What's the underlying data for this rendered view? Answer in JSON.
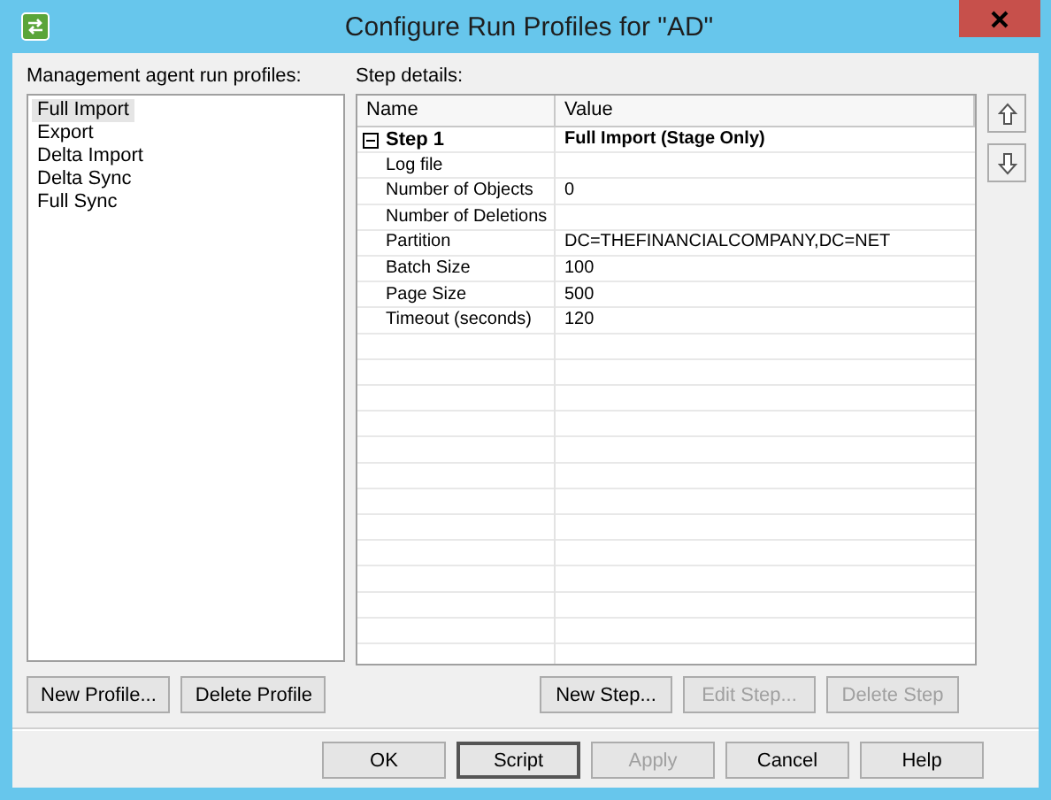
{
  "window": {
    "title": "Configure Run Profiles for \"AD\""
  },
  "profiles": {
    "label": "Management agent run profiles:",
    "items": [
      {
        "label": "Full Import",
        "selected": true
      },
      {
        "label": "Export",
        "selected": false
      },
      {
        "label": "Delta Import",
        "selected": false
      },
      {
        "label": "Delta Sync",
        "selected": false
      },
      {
        "label": "Full Sync",
        "selected": false
      }
    ]
  },
  "step_details": {
    "label": "Step details:",
    "columns": [
      "Name",
      "Value"
    ],
    "step": {
      "name": "Step 1",
      "value": "Full Import (Stage Only)",
      "expanded": true
    },
    "rows": [
      {
        "name": "Log file",
        "value": ""
      },
      {
        "name": "Number of Objects",
        "value": "0"
      },
      {
        "name": "Number of Deletions",
        "value": ""
      },
      {
        "name": "Partition",
        "value": "DC=THEFINANCIALCOMPANY,DC=NET"
      },
      {
        "name": "Batch Size",
        "value": "100"
      },
      {
        "name": "Page Size",
        "value": "500"
      },
      {
        "name": "Timeout (seconds)",
        "value": "120"
      }
    ]
  },
  "profile_buttons": [
    {
      "label": "New Profile...",
      "disabled": false
    },
    {
      "label": "Delete Profile",
      "disabled": false
    }
  ],
  "step_buttons": [
    {
      "label": "New Step...",
      "disabled": false
    },
    {
      "label": "Edit Step...",
      "disabled": true
    },
    {
      "label": "Delete Step",
      "disabled": true
    }
  ],
  "dialog_buttons": [
    {
      "label": "OK",
      "disabled": false,
      "default": false
    },
    {
      "label": "Script",
      "disabled": false,
      "default": true
    },
    {
      "label": "Apply",
      "disabled": true,
      "default": false
    },
    {
      "label": "Cancel",
      "disabled": false,
      "default": false
    },
    {
      "label": "Help",
      "disabled": false,
      "default": false
    }
  ]
}
